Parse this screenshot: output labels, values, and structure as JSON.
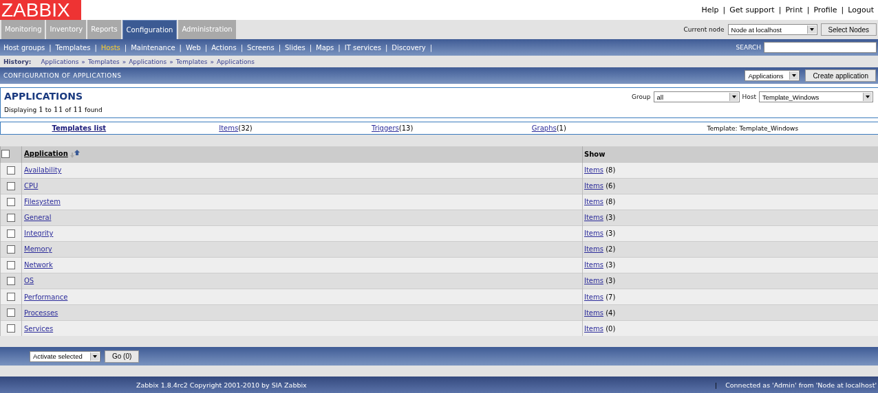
{
  "logo": "ZABBIX",
  "top_links": {
    "separator": "|",
    "items": [
      "Help",
      "Get support",
      "Print",
      "Profile",
      "Logout"
    ]
  },
  "main_tabs": [
    {
      "label": "Monitoring",
      "selected": false
    },
    {
      "label": "Inventory",
      "selected": false
    },
    {
      "label": "Reports",
      "selected": false
    },
    {
      "label": "Configuration",
      "selected": true
    },
    {
      "label": "Administration",
      "selected": false
    }
  ],
  "node": {
    "label": "Current node",
    "value": "Node at localhost",
    "button": "Select Nodes"
  },
  "sub_menu_separator": "|",
  "sub_menu": [
    {
      "label": "Host groups",
      "selected": false
    },
    {
      "label": "Templates",
      "selected": false
    },
    {
      "label": "Hosts",
      "selected": true
    },
    {
      "label": "Maintenance",
      "selected": false
    },
    {
      "label": "Web",
      "selected": false
    },
    {
      "label": "Actions",
      "selected": false
    },
    {
      "label": "Screens",
      "selected": false
    },
    {
      "label": "Slides",
      "selected": false
    },
    {
      "label": "Maps",
      "selected": false
    },
    {
      "label": "IT services",
      "selected": false
    },
    {
      "label": "Discovery",
      "selected": false
    }
  ],
  "search": {
    "label": "SEARCH"
  },
  "history": {
    "label": "History:",
    "items": [
      "Applications",
      "Templates",
      "Applications",
      "Templates",
      "Applications"
    ],
    "separator": "»"
  },
  "title_bar": {
    "title": "CONFIGURATION OF APPLICATIONS",
    "select": "Applications",
    "button": "Create application"
  },
  "panel": {
    "heading": "APPLICATIONS",
    "summary": "Displaying **1** to **11** of **11** found",
    "group_label": "Group",
    "group_value": "all",
    "host_label": "Host",
    "host_value": "Template_Windows"
  },
  "template_links": [
    {
      "kind": "main",
      "link": "Templates list"
    },
    {
      "kind": "count",
      "link": "Items",
      "count": "(32)"
    },
    {
      "kind": "count",
      "link": "Triggers",
      "count": "(13)"
    },
    {
      "kind": "count",
      "link": "Graphs",
      "count": "(1)"
    },
    {
      "kind": "text",
      "text": "Template: Template_Windows"
    }
  ],
  "table": {
    "select_all": {
      "checked": false
    },
    "columns": [
      "Application",
      "Show"
    ],
    "rows": [
      {
        "checked": false,
        "name": "Availability",
        "link": "Items",
        "count": "(8)"
      },
      {
        "checked": false,
        "name": "CPU",
        "link": "Items",
        "count": "(6)"
      },
      {
        "checked": false,
        "name": "Filesystem",
        "link": "Items",
        "count": "(8)"
      },
      {
        "checked": false,
        "name": "General",
        "link": "Items",
        "count": "(3)"
      },
      {
        "checked": false,
        "name": "Integrity",
        "link": "Items",
        "count": "(3)"
      },
      {
        "checked": false,
        "name": "Memory",
        "link": "Items",
        "count": "(2)"
      },
      {
        "checked": false,
        "name": "Network",
        "link": "Items",
        "count": "(3)"
      },
      {
        "checked": false,
        "name": "OS",
        "link": "Items",
        "count": "(3)"
      },
      {
        "checked": false,
        "name": "Performance",
        "link": "Items",
        "count": "(7)"
      },
      {
        "checked": false,
        "name": "Processes",
        "link": "Items",
        "count": "(4)"
      },
      {
        "checked": false,
        "name": "Services",
        "link": "Items",
        "count": "(0)"
      }
    ]
  },
  "actions": {
    "select": "Activate selected",
    "button": "Go (0)"
  },
  "footer": {
    "copyright": "Zabbix 1.8.4rc2 Copyright 2001-2010 by SIA Zabbix",
    "separator": "|",
    "connected": "Connected as 'Admin' from 'Node at localhost'"
  }
}
